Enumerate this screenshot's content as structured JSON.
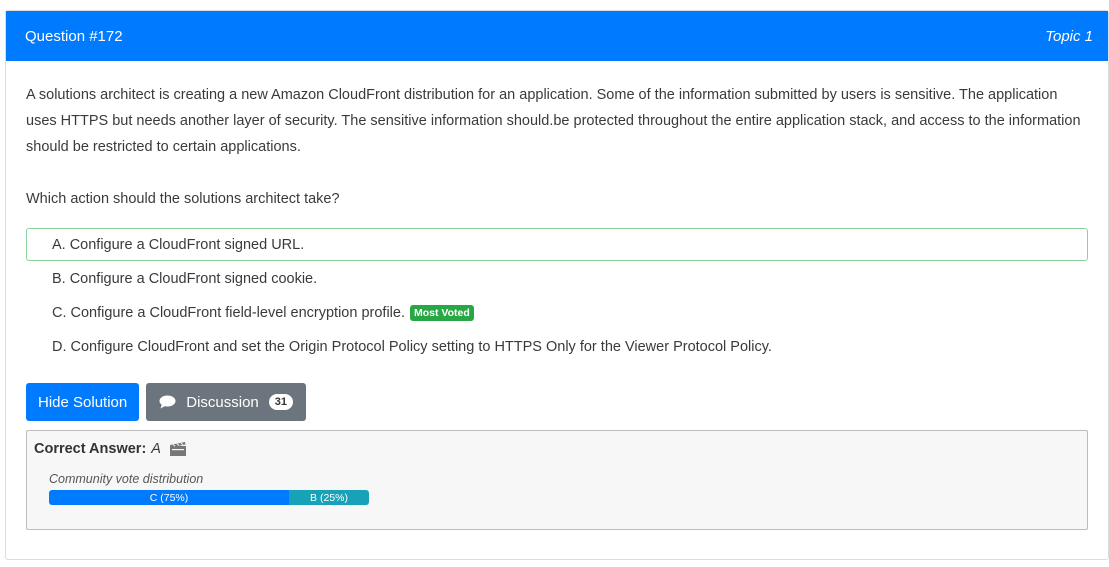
{
  "header": {
    "question_number": "Question #172",
    "topic": "Topic 1"
  },
  "question": {
    "text": "A solutions architect is creating a new Amazon CloudFront distribution for an application. Some of the information submitted by users is sensitive. The application uses HTTPS but needs another layer of security. The sensitive information should.be protected throughout the entire application stack, and access to the information should be restricted to certain applications.",
    "ask": "Which action should the solutions architect take?"
  },
  "choices": [
    {
      "letter": "A.",
      "text": "Configure a CloudFront signed URL."
    },
    {
      "letter": "B.",
      "text": "Configure a CloudFront signed cookie."
    },
    {
      "letter": "C.",
      "text": "Configure a CloudFront field-level encryption profile.",
      "badge": "Most Voted"
    },
    {
      "letter": "D.",
      "text": "Configure CloudFront and set the Origin Protocol Policy setting to HTTPS Only for the Viewer Protocol Policy."
    }
  ],
  "buttons": {
    "hide_solution": "Hide Solution",
    "discussion": "Discussion",
    "discussion_count": "31"
  },
  "answer": {
    "label": "Correct Answer:",
    "value": "A"
  },
  "votes": {
    "title": "Community vote distribution",
    "segments": [
      {
        "label": "C (75%)",
        "percent": 75,
        "color": "#007bff"
      },
      {
        "label": "B (25%)",
        "percent": 25,
        "color": "#17a2b8"
      }
    ]
  },
  "colors": {
    "header_bg": "#007bff",
    "correct_border": "#8fd19e",
    "most_voted": "#28a745",
    "secondary_button": "#6c757d"
  }
}
